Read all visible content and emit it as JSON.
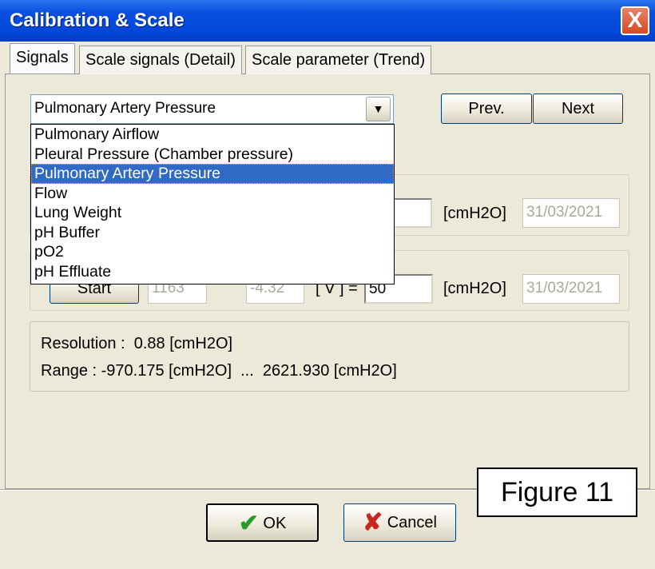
{
  "window": {
    "title": "Calibration & Scale",
    "close": "X"
  },
  "tabs": [
    {
      "label": "Signals",
      "active": true
    },
    {
      "label": "Scale signals (Detail)"
    },
    {
      "label": "Scale parameter (Trend)"
    }
  ],
  "signal_select": {
    "value": "Pulmonary Artery Pressure",
    "arrow": "▼",
    "options": [
      "Pulmonary Airflow",
      "Pleural Pressure (Chamber pressure)",
      "Pulmonary Artery Pressure",
      "Flow",
      "Lung Weight",
      "pH Buffer",
      "pO2",
      "pH Effluate"
    ],
    "selected_index": 2
  },
  "nav": {
    "prev": "Prev.",
    "next": "Next"
  },
  "point1": {
    "unit": "[cmH2O]",
    "date": "31/03/2021"
  },
  "point2": {
    "start": "Start",
    "raw": "1163",
    "volts": "-4.32",
    "eq_label": "[ V ] =",
    "value": "50",
    "unit": "[cmH2O]",
    "date": "31/03/2021"
  },
  "info": {
    "resolution": "Resolution :  0.88 [cmH2O]",
    "range": "Range : -970.175 [cmH2O]  ...  2621.930 [cmH2O]"
  },
  "footer": {
    "ok": "OK",
    "cancel": "Cancel"
  },
  "figure_label": "Figure 11"
}
